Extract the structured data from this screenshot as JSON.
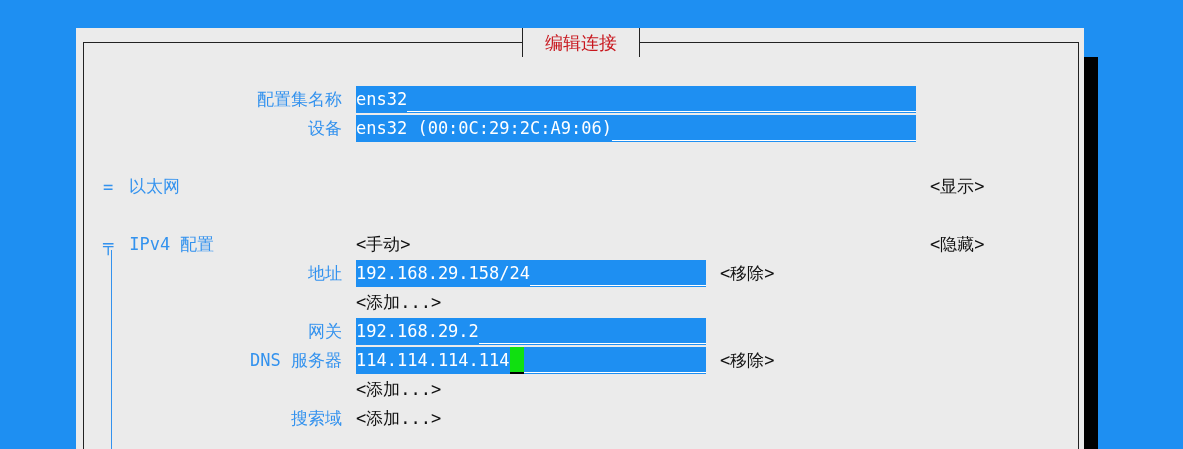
{
  "dialog": {
    "title": "编辑连接"
  },
  "fields": [
    {
      "label": "配置集名称",
      "value": "ens32"
    },
    {
      "label": "设备",
      "value": "ens32 (00:0C:29:2C:A9:06)"
    }
  ],
  "ethernet": {
    "marker": "=",
    "title": "以太网",
    "toggle": "<显示>"
  },
  "ipv4": {
    "marker": "╤",
    "title": "IPv4 配置",
    "mode": "<手动>",
    "toggle": "<隐藏>",
    "rows": [
      {
        "kind": "field",
        "label": "地址",
        "value": "192.168.29.158/24",
        "action": "<移除>",
        "cursor": false
      },
      {
        "kind": "add",
        "button": "<添加...>"
      },
      {
        "kind": "field",
        "label": "网关",
        "value": "192.168.29.2",
        "cursor": false
      },
      {
        "kind": "field",
        "label": "DNS 服务器",
        "value": "114.114.114.114",
        "action": "<移除>",
        "cursor": true
      },
      {
        "kind": "add",
        "button": "<添加...>"
      },
      {
        "kind": "add",
        "label": "搜索域",
        "button": "<添加...>"
      }
    ]
  }
}
